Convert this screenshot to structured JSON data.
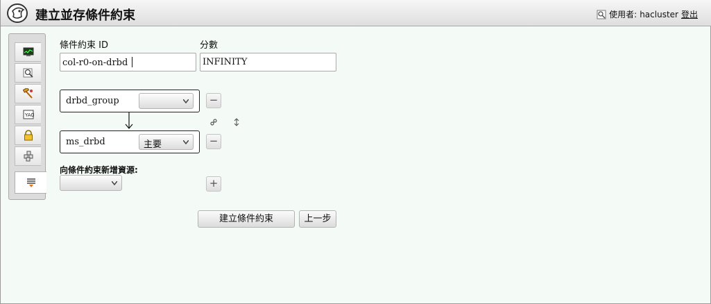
{
  "header": {
    "title": "建立並存條件約束",
    "user_label": "使用者:",
    "username": "hacluster",
    "logout_label": "登出"
  },
  "sidebar": {
    "items": [
      {
        "icon": "monitor-icon"
      },
      {
        "icon": "search-icon"
      },
      {
        "icon": "tools-icon"
      },
      {
        "icon": "id-card-icon"
      },
      {
        "icon": "lock-icon"
      },
      {
        "icon": "cluster-icon"
      },
      {
        "icon": "constraints-icon",
        "active": true
      }
    ]
  },
  "form": {
    "constraint_id_label": "條件約束 ID",
    "constraint_id_value": "col-r0-on-drbd",
    "score_label": "分數",
    "score_value": "INFINITY",
    "resources": [
      {
        "name": "drbd_group",
        "role": ""
      },
      {
        "name": "ms_drbd",
        "role": "主要"
      }
    ],
    "remove_label": "−",
    "add_label": "+",
    "link_icon": "link-icon",
    "swap_icon": "swap-icon",
    "add_resource_label": "向條件約束新增資源:",
    "add_resource_selected": ""
  },
  "actions": {
    "create_label": "建立條件約束",
    "back_label": "上一步"
  }
}
